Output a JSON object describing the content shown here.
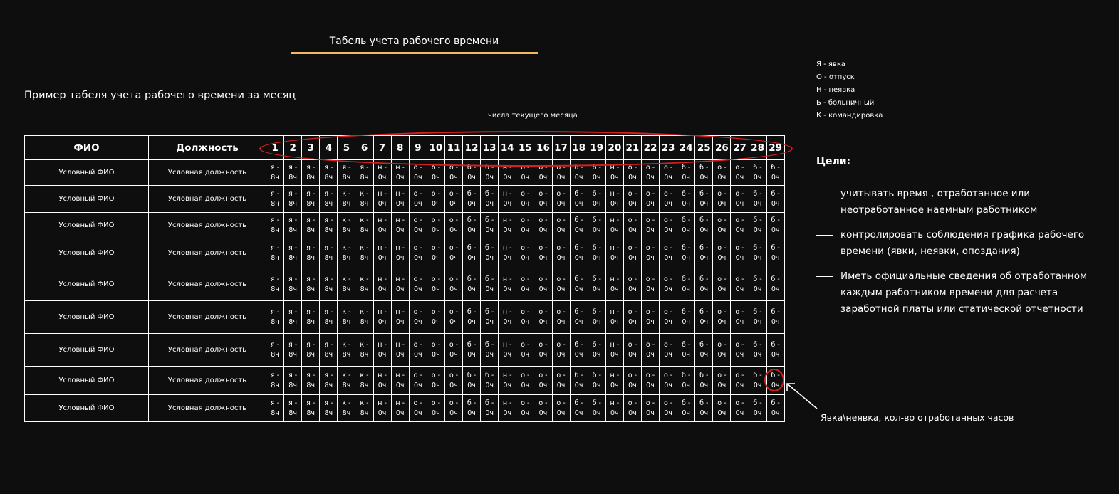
{
  "title": "Табель учета рабочего времени",
  "subtitle": "Пример табеля учета рабочего времени за месяц",
  "days_caption": "числа текущего месяца",
  "legend": [
    "Я - явка",
    "О - отпуск",
    "Н - неявка",
    "Б - больничный",
    "К - командировка"
  ],
  "goals": {
    "title": "Цели:",
    "items": [
      "учитывать время , отработанное или неотработанное наемным работником",
      "контролировать соблюдения графика рабочего времени (явки, неявки, опоздания)",
      "Иметь официальные сведения об отработанном каждым работником времени для расчета заработной платы  или статической отчетности"
    ]
  },
  "annotation": "Явка\\неявка, кол-во отработанных часов",
  "table": {
    "headers": {
      "name": "ФИО",
      "position": "Должность"
    },
    "days": [
      "1",
      "2",
      "3",
      "4",
      "5",
      "6",
      "7",
      "8",
      "9",
      "10",
      "11",
      "12",
      "13",
      "14",
      "15",
      "16",
      "17",
      "18",
      "19",
      "20",
      "21",
      "22",
      "23",
      "24",
      "25",
      "26",
      "27",
      "28",
      "29"
    ],
    "rows": [
      {
        "name": "Условный ФИО",
        "position": "Условная должность",
        "marks": [
          "я - 8ч",
          "я - 8ч",
          "я - 8ч",
          "я - 8ч",
          "я - 8ч",
          "я - 8ч",
          "н - 0ч",
          "н - 0ч",
          "о - 0ч",
          "о - 0ч",
          "о - 0ч",
          "б - 0ч",
          "б - 0ч",
          "н - 0ч",
          "о - 0ч",
          "о - 0ч",
          "о - 0ч",
          "б - 0ч",
          "б - 0ч",
          "н - 0ч",
          "о - 0ч",
          "о - 0ч",
          "о - 0ч",
          "б - 0ч",
          "б - 0ч",
          "о - 0ч",
          "о - 0ч",
          "б - 0ч",
          "б - 0ч"
        ]
      },
      {
        "name": "Условный ФИО",
        "position": "Условная должность",
        "marks": [
          "я - 8ч",
          "я - 8ч",
          "я - 8ч",
          "я - 8ч",
          "к - 8ч",
          "к - 8ч",
          "н - 0ч",
          "н - 0ч",
          "о - 0ч",
          "о - 0ч",
          "о - 0ч",
          "б - 0ч",
          "б - 0ч",
          "н - 0ч",
          "о - 0ч",
          "о - 0ч",
          "о - 0ч",
          "б - 0ч",
          "б - 0ч",
          "н - 0ч",
          "о - 0ч",
          "о - 0ч",
          "о - 0ч",
          "б - 0ч",
          "б - 0ч",
          "о - 0ч",
          "о - 0ч",
          "б - 0ч",
          "б - 0ч"
        ]
      },
      {
        "name": "Условный ФИО",
        "position": "Условная должность",
        "marks": [
          "я - 8ч",
          "я - 8ч",
          "я - 8ч",
          "я - 8ч",
          "к - 8ч",
          "к - 8ч",
          "н - 0ч",
          "н - 0ч",
          "о - 0ч",
          "о - 0ч",
          "о - 0ч",
          "б - 0ч",
          "б - 0ч",
          "н - 0ч",
          "о - 0ч",
          "о - 0ч",
          "о - 0ч",
          "б - 0ч",
          "б - 0ч",
          "н - 0ч",
          "о - 0ч",
          "о - 0ч",
          "о - 0ч",
          "б - 0ч",
          "б - 0ч",
          "о - 0ч",
          "о - 0ч",
          "б - 0ч",
          "б - 0ч"
        ]
      },
      {
        "name": "Условный ФИО",
        "position": "Условная должность",
        "marks": [
          "я - 8ч",
          "я - 8ч",
          "я - 8ч",
          "я - 8ч",
          "к - 8ч",
          "к - 8ч",
          "н - 0ч",
          "н - 0ч",
          "о - 0ч",
          "о - 0ч",
          "о - 0ч",
          "б - 0ч",
          "б - 0ч",
          "н - 0ч",
          "о - 0ч",
          "о - 0ч",
          "о - 0ч",
          "б - 0ч",
          "б - 0ч",
          "н - 0ч",
          "о - 0ч",
          "о - 0ч",
          "о - 0ч",
          "б - 0ч",
          "б - 0ч",
          "о - 0ч",
          "о - 0ч",
          "б - 0ч",
          "б - 0ч"
        ]
      },
      {
        "name": "Условный ФИО",
        "position": "Условная должность",
        "marks": [
          "я - 8ч",
          "я - 8ч",
          "я - 8ч",
          "я - 8ч",
          "к - 8ч",
          "к - 8ч",
          "н - 0ч",
          "н - 0ч",
          "о - 0ч",
          "о - 0ч",
          "о - 0ч",
          "б - 0ч",
          "б - 0ч",
          "н - 0ч",
          "о - 0ч",
          "о - 0ч",
          "о - 0ч",
          "б - 0ч",
          "б - 0ч",
          "н - 0ч",
          "о - 0ч",
          "о - 0ч",
          "о - 0ч",
          "б - 0ч",
          "б - 0ч",
          "о - 0ч",
          "о - 0ч",
          "б - 0ч",
          "б - 0ч"
        ]
      },
      {
        "name": "Условный ФИО",
        "position": "Условная должность",
        "marks": [
          "я - 8ч",
          "я - 8ч",
          "я - 8ч",
          "я - 8ч",
          "к - 8ч",
          "к - 8ч",
          "н - 0ч",
          "н - 0ч",
          "о - 0ч",
          "о - 0ч",
          "о - 0ч",
          "б - 0ч",
          "б - 0ч",
          "н - 0ч",
          "о - 0ч",
          "о - 0ч",
          "о - 0ч",
          "б - 0ч",
          "б - 0ч",
          "н - 0ч",
          "о - 0ч",
          "о - 0ч",
          "о - 0ч",
          "б - 0ч",
          "б - 0ч",
          "о - 0ч",
          "о - 0ч",
          "б - 0ч",
          "б - 0ч"
        ]
      },
      {
        "name": "Условный ФИО",
        "position": "Условная должность",
        "marks": [
          "я - 8ч",
          "я - 8ч",
          "я - 8ч",
          "я - 8ч",
          "к - 8ч",
          "к - 8ч",
          "н - 0ч",
          "н - 0ч",
          "о - 0ч",
          "о - 0ч",
          "о - 0ч",
          "б - 0ч",
          "б - 0ч",
          "н - 0ч",
          "о - 0ч",
          "о - 0ч",
          "о - 0ч",
          "б - 0ч",
          "б - 0ч",
          "н - 0ч",
          "о - 0ч",
          "о - 0ч",
          "о - 0ч",
          "б - 0ч",
          "б - 0ч",
          "о - 0ч",
          "о - 0ч",
          "б - 0ч",
          "б - 0ч"
        ]
      },
      {
        "name": "Условный ФИО",
        "position": "Условная должность",
        "marks": [
          "я - 8ч",
          "я - 8ч",
          "я - 8ч",
          "я - 8ч",
          "к - 8ч",
          "к - 8ч",
          "н - 0ч",
          "н - 0ч",
          "о - 0ч",
          "о - 0ч",
          "о - 0ч",
          "б - 0ч",
          "б - 0ч",
          "н - 0ч",
          "о - 0ч",
          "о - 0ч",
          "о - 0ч",
          "б - 0ч",
          "б - 0ч",
          "н - 0ч",
          "о - 0ч",
          "о - 0ч",
          "о - 0ч",
          "б - 0ч",
          "б - 0ч",
          "о - 0ч",
          "о - 0ч",
          "б - 0ч",
          "б - 0ч"
        ]
      },
      {
        "name": "Условный ФИО",
        "position": "Условная должность",
        "marks": [
          "я - 8ч",
          "я - 8ч",
          "я - 8ч",
          "я - 8ч",
          "к - 8ч",
          "к - 8ч",
          "н - 0ч",
          "н - 0ч",
          "о - 0ч",
          "о - 0ч",
          "о - 0ч",
          "б - 0ч",
          "б - 0ч",
          "н - 0ч",
          "о - 0ч",
          "о - 0ч",
          "о - 0ч",
          "б - 0ч",
          "б - 0ч",
          "н - 0ч",
          "о - 0ч",
          "о - 0ч",
          "о - 0ч",
          "б - 0ч",
          "б - 0ч",
          "о - 0ч",
          "о - 0ч",
          "б - 0ч",
          "б - 0ч"
        ]
      }
    ]
  },
  "colors": {
    "background": "#0e0e0f",
    "title_underline": "#f4b860",
    "highlight": "#d42020",
    "text": "#ffffff"
  }
}
